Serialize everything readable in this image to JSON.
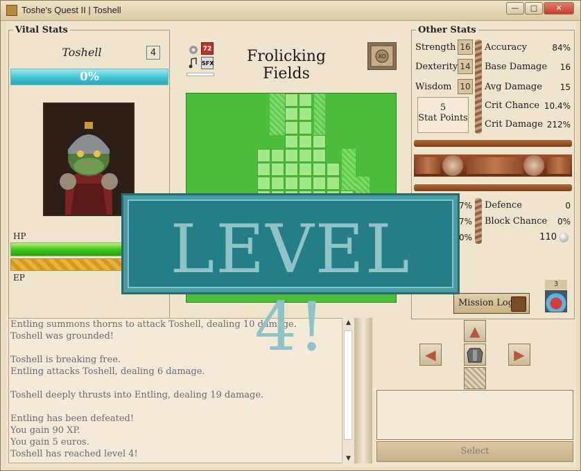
{
  "window": {
    "title": "Toshe's Quest II | Toshell",
    "minimize_glyph": "—",
    "maximize_glyph": "□",
    "close_glyph": "✕"
  },
  "vital_stats": {
    "legend": "Vital Stats",
    "player_name": "Toshell",
    "level": "4",
    "xp_percent_label": "0%",
    "xp_fraction": 0.0,
    "hp_label": "HP",
    "ep_label": "EP",
    "portrait_icon": "frog-knight-portrait"
  },
  "center": {
    "location": "Frolicking Fields",
    "tools": {
      "settings_icon": "gear-icon",
      "calendar_badge": "72",
      "music_icon": "music-note-icon",
      "sfx_label": "SFX"
    },
    "map_button_icon": "map-icon"
  },
  "other_stats": {
    "legend": "Other Stats",
    "base_stats": [
      {
        "label": "Strength",
        "value": "16"
      },
      {
        "label": "Dexterity",
        "value": "14"
      },
      {
        "label": "Wisdom",
        "value": "10"
      }
    ],
    "stat_points": {
      "count": "5",
      "label": "Stat Points"
    },
    "derived": [
      {
        "label": "Accuracy",
        "value": "84%"
      },
      {
        "label": "Base Damage",
        "value": "16"
      },
      {
        "label": "Avg Damage",
        "value": "15"
      },
      {
        "label": "Crit Chance",
        "value": "10.4%"
      },
      {
        "label": "Crit Damage",
        "value": "212%"
      }
    ],
    "resists_partial": [
      "7%",
      "7%",
      "0%"
    ],
    "defence": [
      {
        "label": "Defence",
        "value": "0"
      },
      {
        "label": "Block Chance",
        "value": "0%"
      }
    ],
    "coins": "110",
    "mission_log_label": "Mission Log",
    "potion_count": "3"
  },
  "log": {
    "lines": [
      "Entling summons thorns to attack Toshell, dealing 10 damage.",
      "Toshell was grounded!",
      "",
      "Toshell is breaking free.",
      "Entling attacks Toshell, dealing 6 damage.",
      "",
      "Toshell deeply thrusts into Entling, dealing 19 damage.",
      "",
      "Entling has been defeated!",
      "You gain 90 XP.",
      "You gain 5 euros.",
      "Toshell has reached level 4!"
    ]
  },
  "controls": {
    "select_label": "Select"
  },
  "banner": {
    "text": "LEVEL 4!"
  }
}
